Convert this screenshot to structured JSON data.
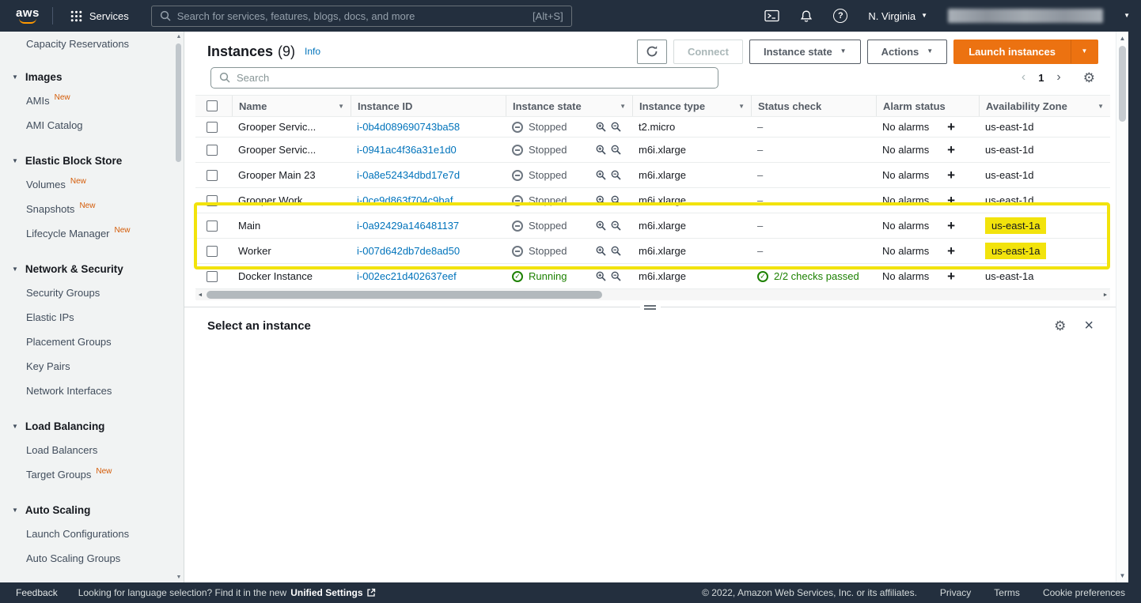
{
  "colors": {
    "nav_bg": "#232f3e",
    "accent_orange": "#ec7211",
    "link_blue": "#0073bb",
    "running_green": "#1d8102",
    "stopped_gray": "#6e7781",
    "highlight_yellow": "#f2e30c"
  },
  "icons": {
    "caret_down": "▼",
    "filter_caret": "▼",
    "section_caret": "▼",
    "chevron_left": "‹",
    "chevron_right": "›",
    "gear": "⚙",
    "close": "×",
    "plus": "+",
    "question_mark": "?",
    "scroll_up": "▲",
    "scroll_down": "▼",
    "scroll_left": "◄",
    "scroll_right": "►"
  },
  "topnav": {
    "logo": "aws",
    "services_label": "Services",
    "search_placeholder": "Search for services, features, blogs, docs, and more",
    "search_shortcut": "[Alt+S]",
    "region_label": "N. Virginia"
  },
  "sidebar": {
    "top_item": "Capacity Reservations",
    "sections": [
      {
        "title": "Images",
        "items": [
          {
            "label": "AMIs",
            "badge": "New"
          },
          {
            "label": "AMI Catalog"
          }
        ]
      },
      {
        "title": "Elastic Block Store",
        "items": [
          {
            "label": "Volumes",
            "badge": "New"
          },
          {
            "label": "Snapshots",
            "badge": "New"
          },
          {
            "label": "Lifecycle Manager",
            "badge": "New"
          }
        ]
      },
      {
        "title": "Network & Security",
        "items": [
          {
            "label": "Security Groups"
          },
          {
            "label": "Elastic IPs"
          },
          {
            "label": "Placement Groups"
          },
          {
            "label": "Key Pairs"
          },
          {
            "label": "Network Interfaces"
          }
        ]
      },
      {
        "title": "Load Balancing",
        "items": [
          {
            "label": "Load Balancers"
          },
          {
            "label": "Target Groups",
            "badge": "New"
          }
        ]
      },
      {
        "title": "Auto Scaling",
        "items": [
          {
            "label": "Launch Configurations"
          },
          {
            "label": "Auto Scaling Groups"
          }
        ]
      }
    ]
  },
  "toolbar": {
    "title": "Instances",
    "count": "(9)",
    "info_label": "Info",
    "connect_label": "Connect",
    "instance_state_label": "Instance state",
    "actions_label": "Actions",
    "launch_label": "Launch instances"
  },
  "controls": {
    "search_placeholder": "Search",
    "page_number": "1"
  },
  "table": {
    "columns": [
      "Name",
      "Instance ID",
      "Instance state",
      "Instance type",
      "Status check",
      "Alarm status",
      "Availability Zone"
    ],
    "rows": [
      {
        "name": "Grooper Servic...",
        "id": "i-0b4d089690743ba58",
        "state": "Stopped",
        "type": "t2.micro",
        "status": "–",
        "alarm": "No alarms",
        "az": "us-east-1d"
      },
      {
        "name": "Grooper Servic...",
        "id": "i-0941ac4f36a31e1d0",
        "state": "Stopped",
        "type": "m6i.xlarge",
        "status": "–",
        "alarm": "No alarms",
        "az": "us-east-1d"
      },
      {
        "name": "Grooper Main 23",
        "id": "i-0a8e52434dbd17e7d",
        "state": "Stopped",
        "type": "m6i.xlarge",
        "status": "–",
        "alarm": "No alarms",
        "az": "us-east-1d"
      },
      {
        "name": "Grooper Work...",
        "id": "i-0ce9d863f704c9baf",
        "state": "Stopped",
        "type": "m6i.xlarge",
        "status": "–",
        "alarm": "No alarms",
        "az": "us-east-1d"
      },
      {
        "name": "Main",
        "id": "i-0a92429a146481137",
        "state": "Stopped",
        "type": "m6i.xlarge",
        "status": "–",
        "alarm": "No alarms",
        "az": "us-east-1a"
      },
      {
        "name": "Worker",
        "id": "i-007d642db7de8ad50",
        "state": "Stopped",
        "type": "m6i.xlarge",
        "status": "–",
        "alarm": "No alarms",
        "az": "us-east-1a"
      },
      {
        "name": "Docker Instance",
        "id": "i-002ec21d402637eef",
        "state": "Running",
        "type": "m6i.xlarge",
        "status": "2/2 checks passed",
        "alarm": "No alarms",
        "az": "us-east-1a"
      }
    ]
  },
  "panel": {
    "title": "Select an instance"
  },
  "footer": {
    "feedback_label": "Feedback",
    "language_text": "Looking for language selection? Find it in the new",
    "language_link": "Unified Settings",
    "copyright": "© 2022, Amazon Web Services, Inc. or its affiliates.",
    "privacy_label": "Privacy",
    "terms_label": "Terms",
    "cookie_label": "Cookie preferences"
  }
}
